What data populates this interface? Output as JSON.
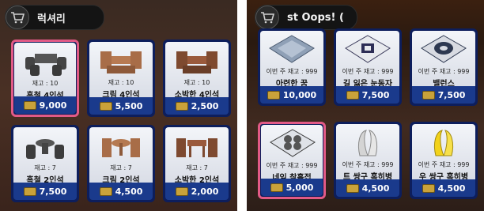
{
  "left": {
    "title": "럭셔리",
    "items": [
      {
        "name": "흑철 4인석",
        "stock": "재고 : 10",
        "price": "9,000"
      },
      {
        "name": "크림 4인석",
        "stock": "재고 : 10",
        "price": "5,500"
      },
      {
        "name": "소박한 4인석",
        "stock": "재고 : 10",
        "price": "2,500"
      },
      {
        "name": "흑철 2인석",
        "stock": "재고 : 7",
        "price": "7,500"
      },
      {
        "name": "크림 2인석",
        "stock": "재고 : 7",
        "price": "4,500"
      },
      {
        "name": "소박한 2인석",
        "stock": "재고 : 7",
        "price": "2,000"
      }
    ]
  },
  "right": {
    "title": "st  Oops! (",
    "items": [
      {
        "name": "아련한 꿈",
        "stock": "이번 주 재고 : 999",
        "price": "10,000"
      },
      {
        "name": "길 잃은 눈동자",
        "stock": "이번 주 재고 : 999",
        "price": "7,500"
      },
      {
        "name": "밸런스",
        "stock": "이번 주 재고 : 999",
        "price": "7,500"
      },
      {
        "name": "네잎 찰흙접",
        "stock": "이번 주 재고 : 999",
        "price": "5,000"
      },
      {
        "name": "트 쌍구 혹히병",
        "stock": "이번 주 재고 : 999",
        "price": "4,500"
      },
      {
        "name": "우  쌍구 혹히병",
        "stock": "이번 주 재고 : 999",
        "price": "4,500"
      }
    ]
  },
  "colors": {
    "card_border": "#0d1e5c",
    "selected": "#e25a86",
    "price_bar": "#1a3a8c"
  },
  "icons": {
    "cart": "cart-icon",
    "currency": "ticket-icon"
  }
}
